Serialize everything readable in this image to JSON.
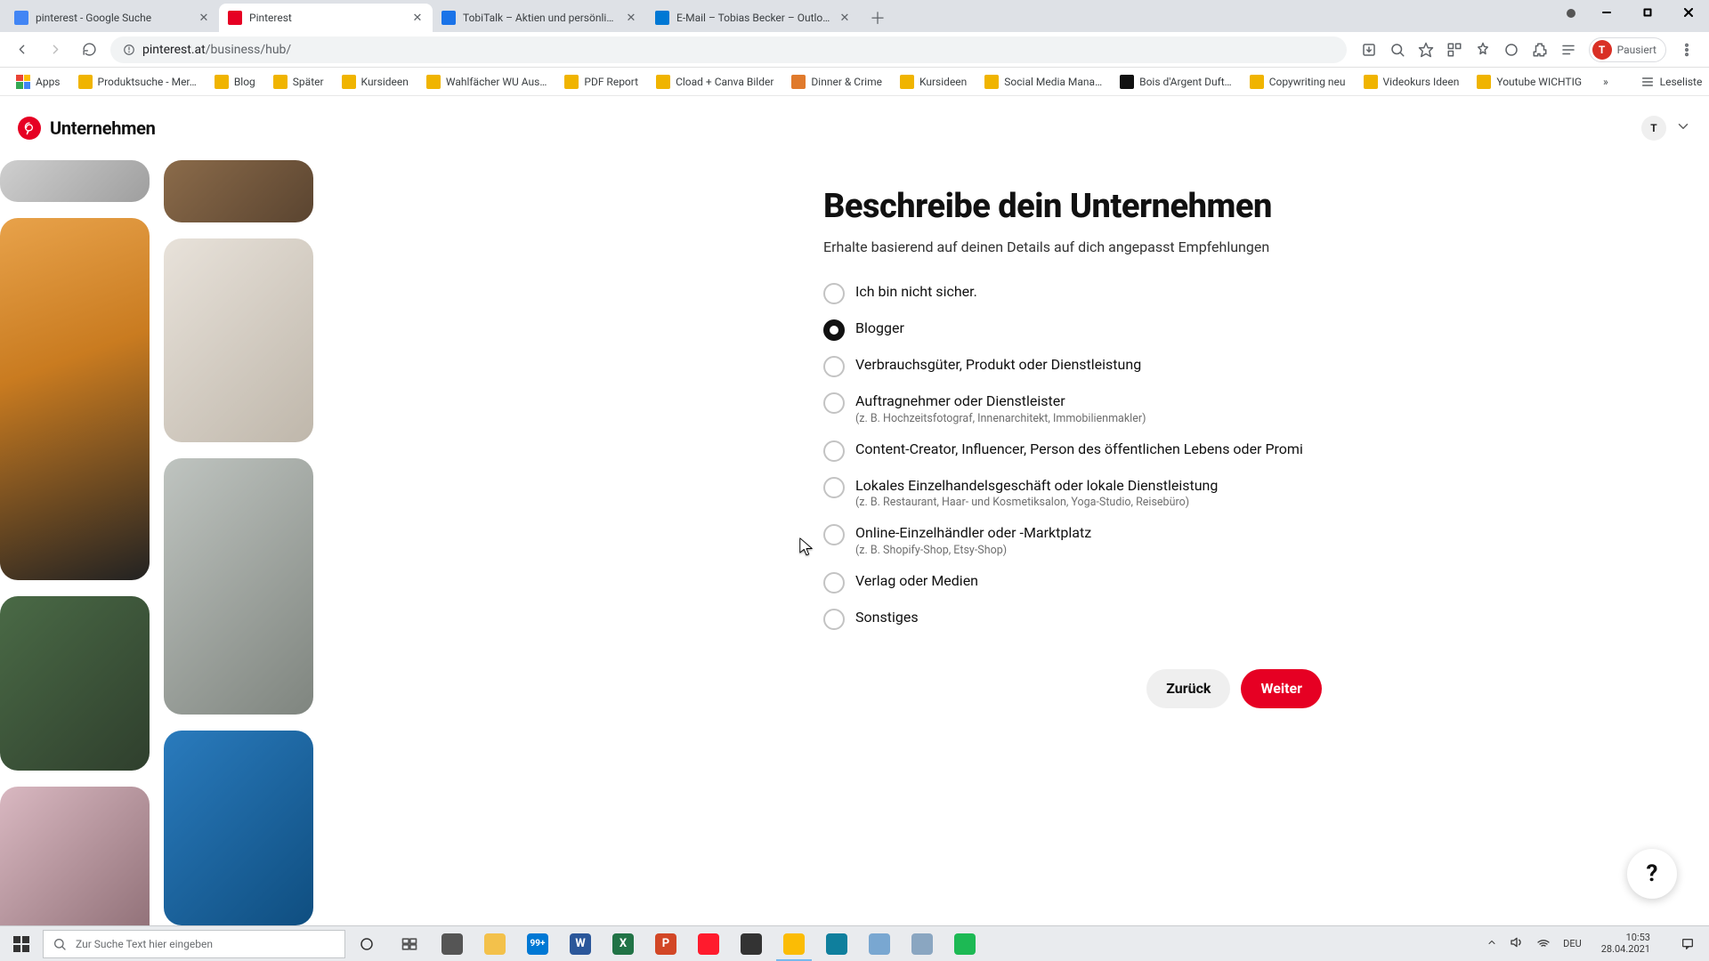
{
  "browser": {
    "tabs": [
      {
        "title": "pinterest - Google Suche",
        "favicon": "#4285f4",
        "active": false
      },
      {
        "title": "Pinterest",
        "favicon": "#e60023",
        "active": true
      },
      {
        "title": "TobiTalk – Aktien und persönlich…",
        "favicon": "#1a73e8",
        "active": false
      },
      {
        "title": "E-Mail – Tobias Becker – Outlook",
        "favicon": "#0078d4",
        "active": false
      }
    ],
    "address": {
      "host": "pinterest.at",
      "path": "/business/hub/"
    },
    "profile": {
      "initial": "T",
      "label": "Pausiert"
    },
    "bookmarks": [
      {
        "label": "Apps",
        "color": "#5f6368"
      },
      {
        "label": "Produktsuche - Mer…",
        "color": "#f0b400"
      },
      {
        "label": "Blog",
        "color": "#f0b400"
      },
      {
        "label": "Später",
        "color": "#f0b400"
      },
      {
        "label": "Kursideen",
        "color": "#f0b400"
      },
      {
        "label": "Wahlfächer WU Aus…",
        "color": "#f0b400"
      },
      {
        "label": "PDF Report",
        "color": "#f0b400"
      },
      {
        "label": "Cload + Canva Bilder",
        "color": "#f0b400"
      },
      {
        "label": "Dinner & Crime",
        "color": "#e07a2c"
      },
      {
        "label": "Kursideen",
        "color": "#f0b400"
      },
      {
        "label": "Social Media Mana…",
        "color": "#f0b400"
      },
      {
        "label": "Bois d'Argent Duft…",
        "color": "#111"
      },
      {
        "label": "Copywriting neu",
        "color": "#f0b400"
      },
      {
        "label": "Videokurs Ideen",
        "color": "#f0b400"
      },
      {
        "label": "Youtube WICHTIG",
        "color": "#f0b400"
      }
    ],
    "reading_list": "Leseliste"
  },
  "page_header": {
    "brand": "Unternehmen",
    "account_initial": "T"
  },
  "form": {
    "title": "Beschreibe dein Unternehmen",
    "subtitle": "Erhalte basierend auf deinen Details auf dich angepasst Empfehlungen",
    "options": [
      {
        "label": "Ich bin nicht sicher.",
        "hint": "",
        "selected": false
      },
      {
        "label": "Blogger",
        "hint": "",
        "selected": true
      },
      {
        "label": "Verbrauchsgüter, Produkt oder Dienstleistung",
        "hint": "",
        "selected": false
      },
      {
        "label": "Auftragnehmer oder Dienstleister",
        "hint": "(z. B. Hochzeitsfotograf, Innenarchitekt, Immobilienmakler)",
        "selected": false
      },
      {
        "label": "Content-Creator, Influencer, Person des öffentlichen Lebens oder Promi",
        "hint": "",
        "selected": false
      },
      {
        "label": "Lokales Einzelhandelsgeschäft oder lokale Dienstleistung",
        "hint": "(z. B. Restaurant, Haar- und Kosmetiksalon, Yoga-Studio, Reisebüro)",
        "selected": false
      },
      {
        "label": "Online-Einzelhändler oder -Marktplatz",
        "hint": "(z. B. Shopify-Shop, Etsy-Shop)",
        "selected": false
      },
      {
        "label": "Verlag oder Medien",
        "hint": "",
        "selected": false
      },
      {
        "label": "Sonstiges",
        "hint": "",
        "selected": false
      }
    ],
    "back_label": "Zurück",
    "next_label": "Weiter"
  },
  "help": {
    "glyph": "?"
  },
  "taskbar": {
    "search_placeholder": "Zur Suche Text hier eingeben",
    "clock_time": "10:53",
    "clock_date": "28.04.2021",
    "apps": [
      {
        "name": "task-view",
        "color": "#555"
      },
      {
        "name": "explorer",
        "color": "#f3c14b"
      },
      {
        "name": "mail",
        "color": "#0078d4",
        "badge": "99+"
      },
      {
        "name": "word",
        "color": "#2b579a",
        "letter": "W"
      },
      {
        "name": "excel",
        "color": "#217346",
        "letter": "X"
      },
      {
        "name": "powerpoint",
        "color": "#d24726",
        "letter": "P"
      },
      {
        "name": "opera",
        "color": "#ff1b2d"
      },
      {
        "name": "obs",
        "color": "#333"
      },
      {
        "name": "chrome",
        "color": "#fbbc05",
        "active": true
      },
      {
        "name": "edge",
        "color": "#0f7f9d"
      },
      {
        "name": "notepad",
        "color": "#79a7d1"
      },
      {
        "name": "wordpad",
        "color": "#8aa6c1"
      },
      {
        "name": "spotify",
        "color": "#1db954"
      }
    ]
  }
}
